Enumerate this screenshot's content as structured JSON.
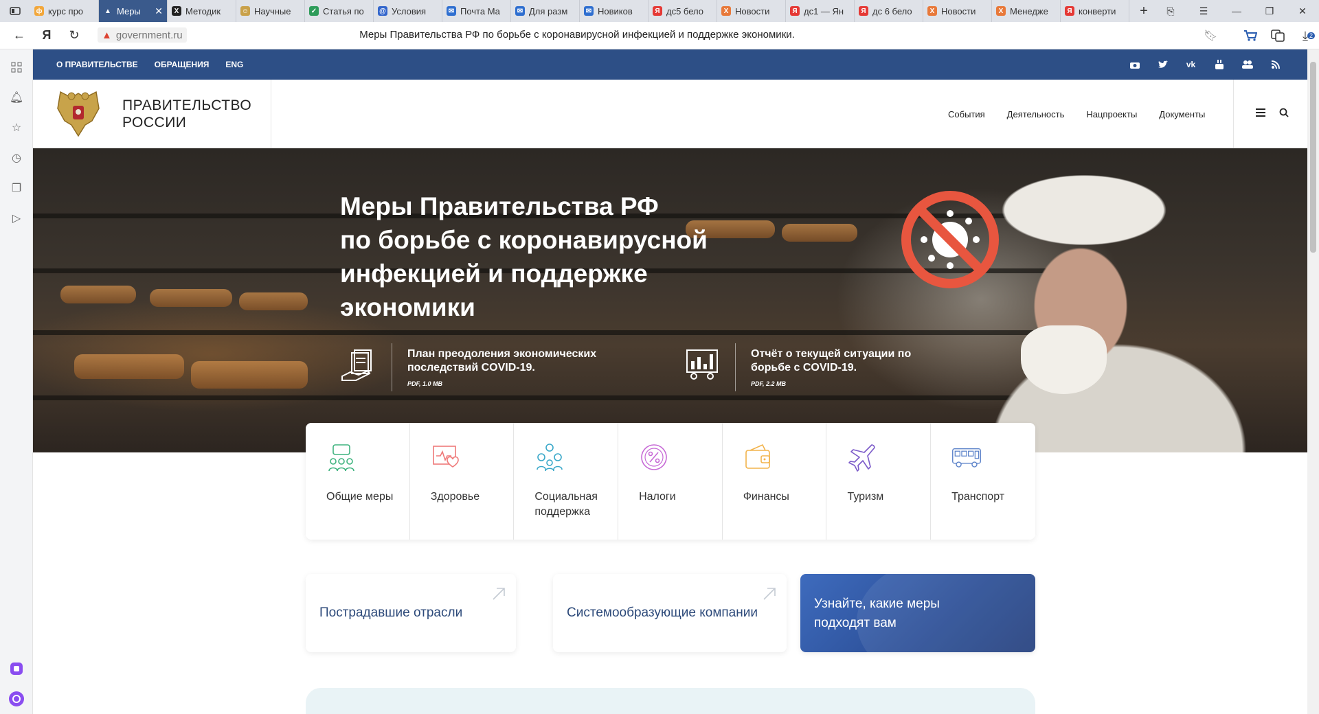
{
  "browser": {
    "tabs": [
      {
        "title": "курс про",
        "color": "#f2a73b",
        "glyph": "ф",
        "active": false
      },
      {
        "title": "Меры",
        "color": "#3a5a8c",
        "glyph": "▲",
        "active": true
      },
      {
        "title": "Методик",
        "color": "#222222",
        "glyph": "X",
        "active": false
      },
      {
        "title": "Научные",
        "color": "#c9a14a",
        "glyph": "☺",
        "active": false
      },
      {
        "title": "Статья по",
        "color": "#2e9c5a",
        "glyph": "✓",
        "active": false
      },
      {
        "title": "Условия",
        "color": "#3366cc",
        "glyph": "@",
        "active": false
      },
      {
        "title": "Почта Ма",
        "color": "#2f6fd0",
        "glyph": "✉",
        "active": false
      },
      {
        "title": "Для разм",
        "color": "#2f6fd0",
        "glyph": "✉",
        "active": false
      },
      {
        "title": "Новиков",
        "color": "#2f6fd0",
        "glyph": "✉",
        "active": false
      },
      {
        "title": "дс5 бело",
        "color": "#e53935",
        "glyph": "Я",
        "active": false
      },
      {
        "title": "Новости",
        "color": "#e8793a",
        "glyph": "X",
        "active": false
      },
      {
        "title": "дс1 — Ян",
        "color": "#e53935",
        "glyph": "Я",
        "active": false
      },
      {
        "title": "дс 6 бело",
        "color": "#e53935",
        "glyph": "Я",
        "active": false
      },
      {
        "title": "Новости",
        "color": "#e8793a",
        "glyph": "X",
        "active": false
      },
      {
        "title": "Менедже",
        "color": "#e8793a",
        "glyph": "X",
        "active": false
      },
      {
        "title": "конверти",
        "color": "#e53935",
        "glyph": "Я",
        "active": false
      }
    ],
    "domain": "government.ru",
    "page_title": "Меры Правительства РФ по борьбе с коронавирусной инфекцией и поддержке экономики.",
    "download_badge": "2"
  },
  "topnav": {
    "links": [
      "О ПРАВИТЕЛЬСТВЕ",
      "ОБРАЩЕНИЯ",
      "ENG"
    ],
    "socials": [
      "camera-icon",
      "twitter-icon",
      "vk-icon",
      "youtube-icon",
      "users-icon",
      "rss-icon"
    ],
    "color": "#2d4f86"
  },
  "header": {
    "gov_line1": "ПРАВИТЕЛЬСТВО",
    "gov_line2": "РОССИИ",
    "nav": [
      "События",
      "Деятельность",
      "Нацпроекты",
      "Документы"
    ]
  },
  "hero": {
    "title_lines": [
      "Меры Правительства РФ",
      "по борьбе с коронавирусной",
      "инфекцией и поддержке",
      "экономики"
    ],
    "docs": [
      {
        "text": "План преодоления экономических последствий COVID-19.",
        "meta": "PDF, 1.0 MB"
      },
      {
        "text": "Отчёт о текущей ситуации по борьбе с COVID-19.",
        "meta": "PDF, 2.2 MB"
      }
    ],
    "badge_color": "#e8563f"
  },
  "categories": [
    {
      "label": "Общие меры",
      "icon": "people-icon",
      "color": "#3fb37f"
    },
    {
      "label": "Здоровье",
      "icon": "health-monitor-icon",
      "color": "#ef7a7a"
    },
    {
      "label": "Социальная поддержка",
      "icon": "family-icon",
      "color": "#3aa8c9"
    },
    {
      "label": "Налоги",
      "icon": "percent-icon",
      "color": "#c76ad6"
    },
    {
      "label": "Финансы",
      "icon": "wallet-icon",
      "color": "#f2b34b"
    },
    {
      "label": "Туризм",
      "icon": "plane-icon",
      "color": "#7b5ac9"
    },
    {
      "label": "Транспорт",
      "icon": "bus-icon",
      "color": "#5b82c9"
    }
  ],
  "cards": [
    {
      "label": "Пострадавшие отрасли"
    },
    {
      "label": "Системообразующие компании"
    },
    {
      "label": "Узнайте, какие меры подходят вам"
    }
  ]
}
